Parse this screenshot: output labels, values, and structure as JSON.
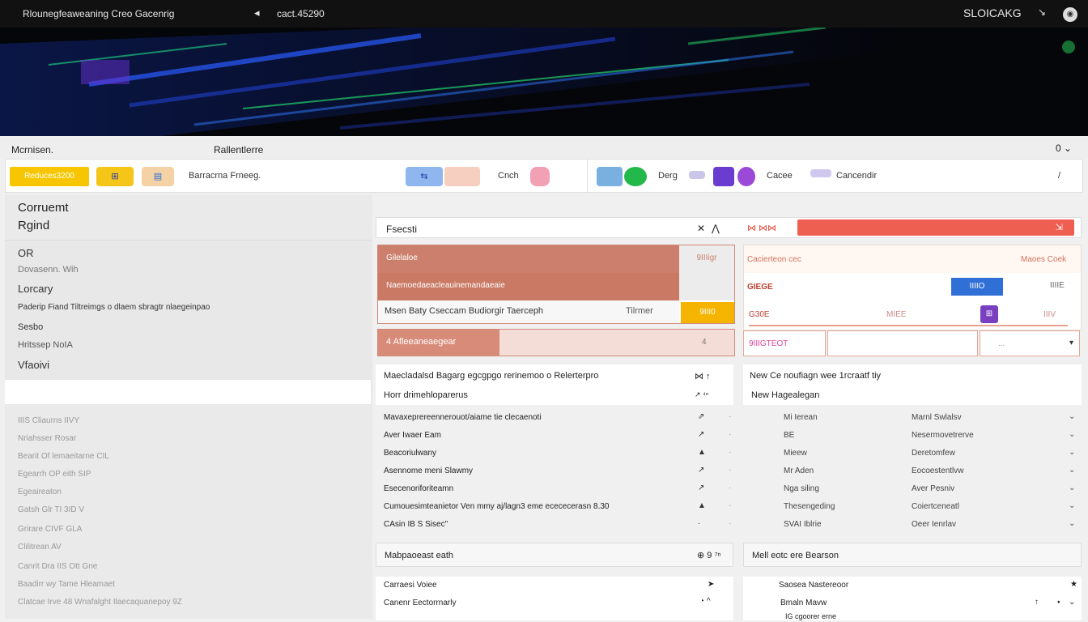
{
  "topbar": {
    "brand": "Rlounegfeaweaning  Creo  Gacenrig",
    "back_icon": "◂",
    "address": "cact.45290",
    "account": "SLOICAKG",
    "cursor_icon": "↘",
    "avatar_label": "◉"
  },
  "menu": {
    "left": "Mcrnisen.",
    "middle": "Rallentlerre",
    "right": "0 ⌄"
  },
  "toolbar": {
    "yellow_btn": "Reduces3200",
    "chip1": "⊞",
    "chip2": "▤",
    "text1": "Barracrna  Frneeg.",
    "chip3": "⇆",
    "text2": "Cnch",
    "text3": "Derg",
    "text4": "Cacee",
    "text5": "Cancendir",
    "text6": "/"
  },
  "left_panel": {
    "title_line1": "Corruemt",
    "title_line2": "Rgind",
    "nav": [
      "OR",
      "Dovasenn. Wih",
      "Lorcary",
      "Paderip Fiand  Tiltreimgs  o dlaem  sbragtr nlaegeinpao",
      "Sesbo",
      "Hritssep  NoIA",
      "Vfaoivi"
    ],
    "list": [
      "IIIS  Cliaurns IIVY",
      "Nriahsser  Rosar",
      "Bearit  Of lemaeitarne  CIL",
      "Egearrh  OP  eith  SIP",
      "Egeaireaton",
      "Gatsh  Glr  TI  3ID  V",
      "Grirare  CIVF  GLA",
      "Clilitrean  AV",
      "Canrit  Dra  IIS  Ott  Gne",
      "Baadirr  wy Tame  Hleamaet",
      "Clatcae Irve  48  Wnafalght  Ilaecaquanepoy  9Z"
    ]
  },
  "center": {
    "header_label": "Fsecsti",
    "header_x": "✕",
    "header_a": "⋀",
    "header_arrows": "⋈ ⋈⋈",
    "header_icon": "⇲",
    "progress_fraction": 0.34,
    "card_a": {
      "r1": "Gilelaloe",
      "r1_side": "9IIIigr",
      "r2": "Naemoedaeacleauinemandaeaie",
      "r3": "Msen  Baty  Cseccam  Budiorgir   Taerceph",
      "r3_right": "Tilrmer",
      "gold": "9III0"
    },
    "card_b": {
      "label": "4  Afleeaneaegear",
      "n": "4"
    },
    "card_c": {
      "head_left": "Cacierteon  cec",
      "head_right": "Maoes  Coek",
      "r2_left": "GIEGE",
      "r2_blue": "IIIIO",
      "r2_right": "IIIIE",
      "r3_left": "G30E",
      "r3_mid": "MIEE",
      "r3_icon": "⊞",
      "r3_right": "IIIV"
    },
    "card_d": {
      "f1": "9IIIGTEOT",
      "f3_c": "...",
      "f3_v": "▾"
    },
    "info_a": {
      "l1": "Maecladalsd  Bagarg  egcgpgo  rerinemoo  o  Relerterpro",
      "l2": "Horr  drimehloparerus",
      "r1": "⋈  ↑",
      "r2": "↗  ⁴ⁿ"
    },
    "info_b": {
      "l1": "New  Ce  noufiagn  wee  1rcraatf  tiy",
      "l2": "New  Hagealegan"
    },
    "rows_a": [
      {
        "label": "Mavaxeprereennerouot/aiame  tie  clecaenoti",
        "icon": "⇗",
        "dot": "·"
      },
      {
        "label": "Aver  Iwaer Eam",
        "icon": "↗",
        "dot": "·"
      },
      {
        "label": "Beacoriulwany",
        "icon": "▲",
        "dot": "·"
      },
      {
        "label": "Asennome  meni  Slawmy",
        "icon": "↗",
        "dot": "·"
      },
      {
        "label": "Esecenoriforiteamn",
        "icon": "↗",
        "dot": "·"
      },
      {
        "label": "Cumouesimteanietor  Ven  mmy  aj/lagn3   eme  ecececerasn  8.30",
        "icon": "▲",
        "dot": "·"
      },
      {
        "label": "CAsin  IB  S  Sisec\"",
        "icon": "·",
        "dot": "·"
      }
    ],
    "rows_b": [
      {
        "label": "Mi  Ierean",
        "value": "Marnl  Swlalsv",
        "chev": "⌄"
      },
      {
        "label": "BE",
        "value": "Nesermovetrerve",
        "chev": "⌄"
      },
      {
        "label": "Mieew",
        "value": "Deretomfew",
        "chev": "⌄"
      },
      {
        "label": "Mr  Aden",
        "value": "Eocoestentlvw",
        "chev": "⌄"
      },
      {
        "label": "Nga  siling",
        "value": "Aver  Pesniv",
        "chev": "⌄"
      },
      {
        "label": "Thesengeding",
        "value": "Coiertceneatl",
        "chev": "⌄"
      },
      {
        "label": "SVAI  Iblrie",
        "value": "Oeer  Ienrlav",
        "chev": "⌄"
      }
    ],
    "bar_a": {
      "label": "Mabpaoeast  eath",
      "right": "⊕  9 ⁷ⁿ"
    },
    "bar_b": {
      "label": "Mell  eotc  ere  Bearson"
    },
    "foot_a": {
      "l1": "Carraesi  Voiee",
      "l2": "Canenr  Eectorrnarly",
      "r1": "➤",
      "r2": "◔ ^"
    },
    "foot_b": {
      "l1": "Saosea  Nastereoor",
      "l2": "Bmaln  Mavw",
      "l3": "IG  cgoorer erne",
      "r1": "★",
      "r2": "↑",
      "r3": "⬩",
      "r4": "⌄"
    }
  },
  "colors": {
    "accent_red": "#ee5e51",
    "accent_yellow": "#f7c600",
    "accent_blue": "#2f6fd6",
    "accent_purple": "#7a3fc0"
  }
}
